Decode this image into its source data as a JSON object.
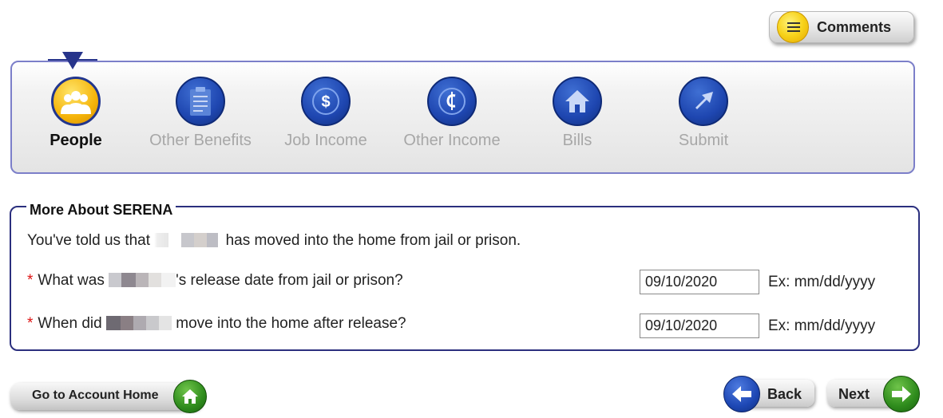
{
  "comments": {
    "label": "Comments",
    "icon": "comments-icon"
  },
  "steps": [
    {
      "label": "People",
      "icon": "people-icon",
      "active": true
    },
    {
      "label": "Other Benefits",
      "icon": "clipboard-icon",
      "active": false
    },
    {
      "label": "Job Income",
      "icon": "dollar-icon",
      "active": false
    },
    {
      "label": "Other Income",
      "icon": "cents-icon",
      "active": false
    },
    {
      "label": "Bills",
      "icon": "home-icon",
      "active": false
    },
    {
      "label": "Submit",
      "icon": "arrow-icon",
      "active": false
    }
  ],
  "form": {
    "legend": "More About SERENA",
    "intro_before": "You've told us that",
    "intro_after": "has moved into the home from jail or prison.",
    "q1_before": "What was",
    "q1_after": "'s release date from jail or prison?",
    "q1_value": "09/10/2020",
    "q1_hint": "Ex: mm/dd/yyyy",
    "q2_before": "When did",
    "q2_after": "move into the home after release?",
    "q2_value": "09/10/2020",
    "q2_hint": "Ex: mm/dd/yyyy",
    "required_marker": "*"
  },
  "footer": {
    "account_home_label": "Go to Account Home",
    "back_label": "Back",
    "next_label": "Next"
  },
  "colors": {
    "accent_blue": "#1e46b0",
    "active_gold": "#f5b40a",
    "border_purple": "#7c7fc9",
    "required_red": "#d11111",
    "green": "#2e8b1c"
  }
}
